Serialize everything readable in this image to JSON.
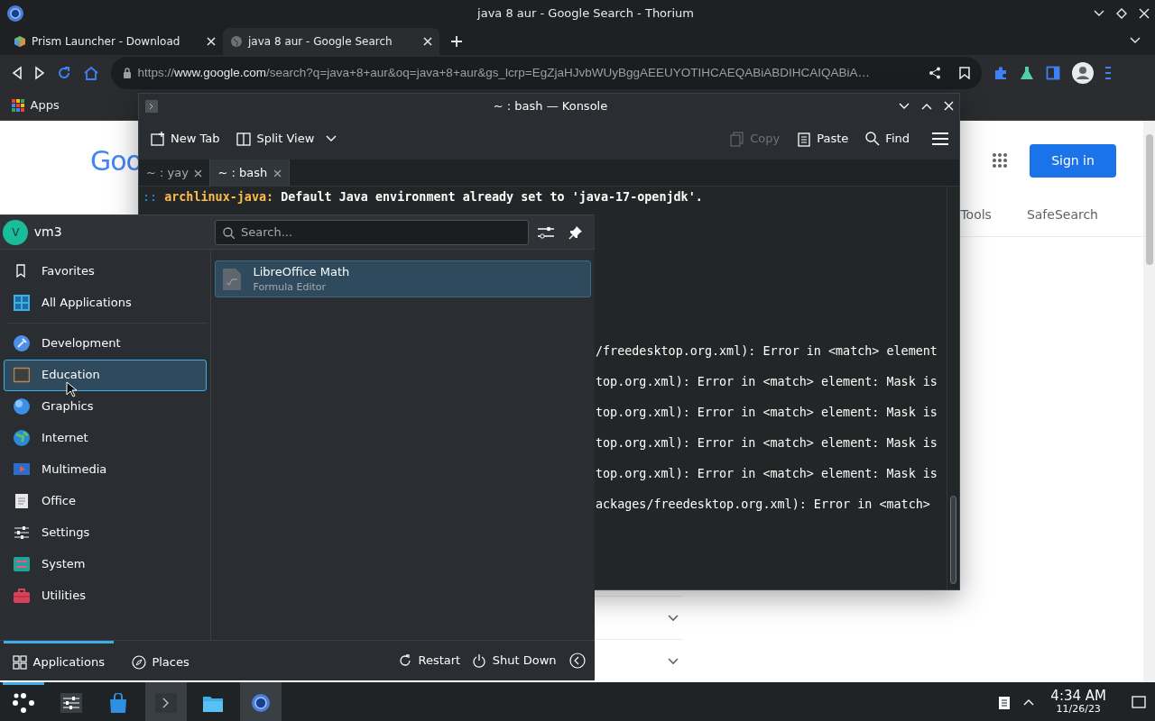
{
  "browser": {
    "title": "java 8 aur - Google Search - Thorium",
    "tabs": [
      {
        "label": "Prism Launcher - Download",
        "selected": false
      },
      {
        "label": "java 8 aur - Google Search",
        "selected": true
      }
    ],
    "url": {
      "scheme": "https://",
      "host": "www.google.com",
      "path": "/search?q=java+8+aur&oq=java+8+aur&gs_lcrp=EgZjaHJvbWUyBggAEEUYOTIHCAEQABiABDIHCAIQABiA…"
    },
    "bookmarks": [
      "Apps"
    ],
    "page": {
      "logo": "Goo",
      "sign_in": "Sign in",
      "filters": [
        "Tools",
        "SafeSearch"
      ]
    }
  },
  "konsole": {
    "title": "~ : bash — Konsole",
    "toolbar": [
      {
        "label": "New Tab",
        "kind": "newtab",
        "disabled": false
      },
      {
        "label": "Split View",
        "kind": "split",
        "disabled": false
      },
      {
        "label": "Copy",
        "kind": "copy",
        "disabled": true
      },
      {
        "label": "Paste",
        "kind": "paste",
        "disabled": false
      },
      {
        "label": "Find",
        "kind": "find",
        "disabled": false
      }
    ],
    "tabs": [
      {
        "label": "~ : yay",
        "selected": false
      },
      {
        "label": "~ : bash",
        "selected": true
      }
    ],
    "lines": [
      [
        {
          "text": ":: ",
          "kind": "marker"
        },
        {
          "text": "archlinux-java:",
          "kind": "label"
        },
        {
          "text": " Default Java environment already set to 'java-17-openjdk'.",
          "kind": "bold"
        }
      ]
    ],
    "visible_lines": [
      "/freedesktop.org.xml): Error in <match> element",
      "top.org.xml): Error in <match> element: Mask is",
      "top.org.xml): Error in <match> element: Mask is",
      "top.org.xml): Error in <match> element: Mask is",
      "top.org.xml): Error in <match> element: Mask is",
      "ackages/freedesktop.org.xml): Error in <match>"
    ]
  },
  "menu": {
    "user": "vm3",
    "avatar": "V",
    "search": {
      "placeholder": "Search..."
    },
    "places": [
      {
        "label": "Favorites",
        "selected": false
      },
      {
        "label": "All Applications",
        "selected": false
      }
    ],
    "categories": [
      {
        "label": "Development",
        "selected": false
      },
      {
        "label": "Education",
        "selected": true
      },
      {
        "label": "Graphics",
        "selected": false
      },
      {
        "label": "Internet",
        "selected": false
      },
      {
        "label": "Multimedia",
        "selected": false
      },
      {
        "label": "Office",
        "selected": false
      },
      {
        "label": "Settings",
        "selected": false
      },
      {
        "label": "System",
        "selected": false
      },
      {
        "label": "Utilities",
        "selected": false
      }
    ],
    "apps": [
      {
        "name": "LibreOffice Math",
        "description": "Formula Editor",
        "selected": true
      }
    ],
    "footer_tabs": [
      {
        "label": "Applications",
        "selected": true
      },
      {
        "label": "Places",
        "selected": false
      }
    ],
    "actions": [
      "Restart",
      "Shut Down"
    ]
  },
  "taskbar": {
    "items": [
      {
        "kind": "launcher",
        "active": true
      },
      {
        "kind": "settings",
        "active": false
      },
      {
        "kind": "store",
        "active": false
      },
      {
        "kind": "terminal",
        "active": true
      },
      {
        "kind": "files",
        "active": false
      },
      {
        "kind": "browser",
        "active": true
      }
    ],
    "time": "4:34 AM",
    "date": "11/26/23"
  }
}
